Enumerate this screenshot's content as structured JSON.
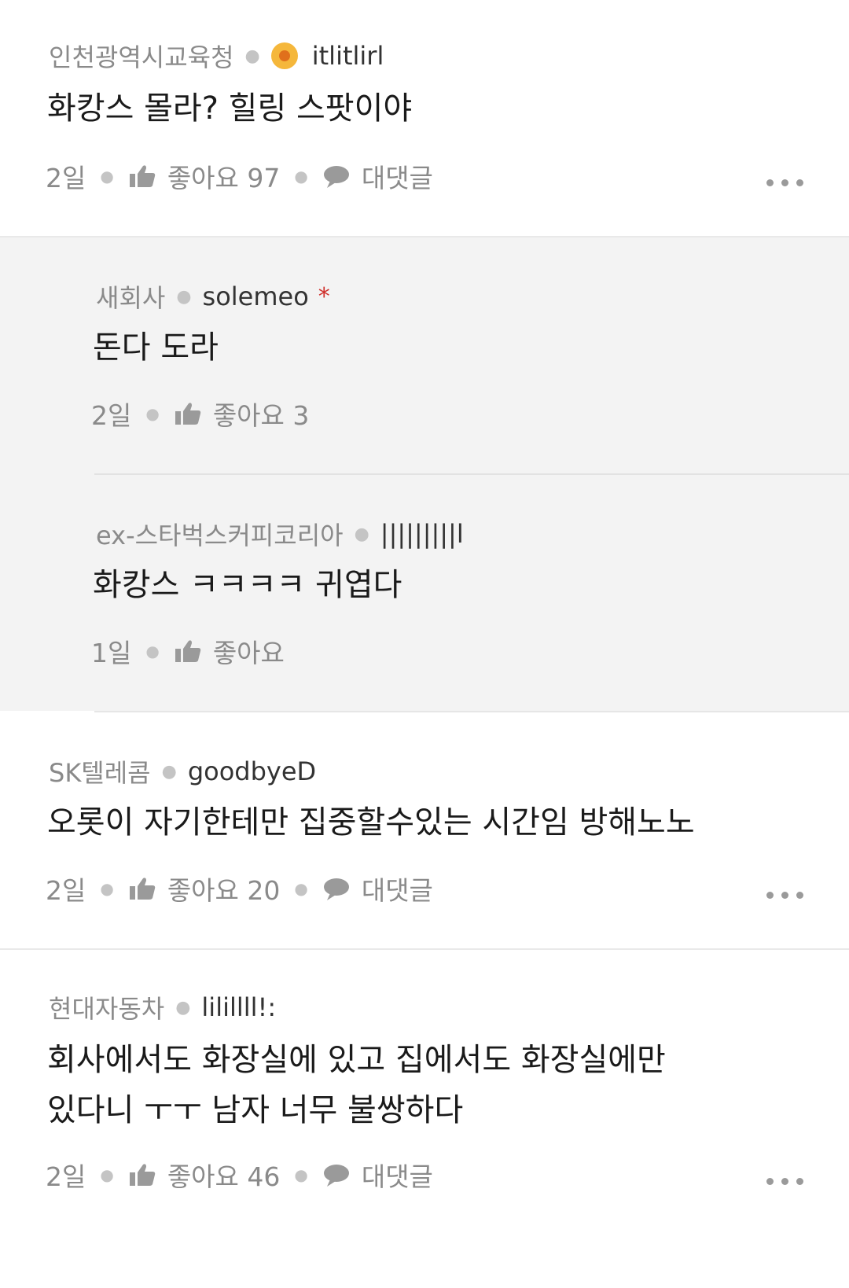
{
  "comments": [
    {
      "company": "인천광역시교육청",
      "user": "itlitlirl",
      "text": "화캉스 몰라? 힐링 스팟이야",
      "time": "2일",
      "likes": "좋아요 97",
      "reply": "대댓글"
    },
    {
      "company": "새회사",
      "user": "solemeo",
      "text": "돈다 도라",
      "time": "2일",
      "likes": "좋아요 3"
    },
    {
      "company": "ex-스타벅스커피코리아",
      "user": "|||||||||l",
      "text": "화캉스 ㅋㅋㅋㅋ 귀엽다",
      "time": "1일",
      "likes": "좋아요"
    },
    {
      "company": "SK텔레콤",
      "user": "goodbyeD",
      "text": "오롯이 자기한테만 집중할수있는 시간임 방해노노",
      "time": "2일",
      "likes": "좋아요 20",
      "reply": "대댓글"
    },
    {
      "company": "현대자동차",
      "user": "lilillll!:",
      "text_line1": "회사에서도 화장실에 있고 집에서도 화장실에만",
      "text_line2": "있다니 ㅜㅜ 남자 너무 불쌍하다",
      "time": "2일",
      "likes": "좋아요 46",
      "reply": "대댓글"
    }
  ],
  "icons": {
    "like": "thumbs-up-icon",
    "reply": "speech-bubble-icon",
    "more": "more-dots-icon",
    "badge": "gold-badge-icon",
    "star": "red-asterisk-icon"
  },
  "colors": {
    "reply_background": "#f3f3f3",
    "meta_gray": "#8a8a8a",
    "badge_gold": "#f5b73b",
    "asterisk_red": "#d0312d"
  }
}
